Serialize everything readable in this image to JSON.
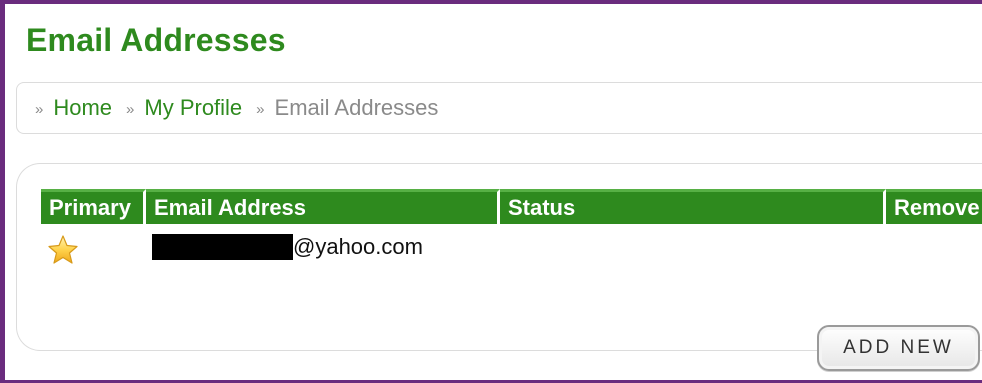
{
  "page": {
    "title": "Email Addresses"
  },
  "breadcrumb": {
    "items": [
      {
        "label": "Home",
        "link": true
      },
      {
        "label": "My Profile",
        "link": true
      },
      {
        "label": "Email Addresses",
        "link": false
      }
    ],
    "separator": "»"
  },
  "table": {
    "headers": [
      "Primary",
      "Email Address",
      "Status",
      "Remove"
    ],
    "rows": [
      {
        "primary": true,
        "email_suffix": "@yahoo.com",
        "status": ""
      }
    ]
  },
  "buttons": {
    "add_new": "ADD NEW"
  },
  "colors": {
    "brand_green": "#2e8a1e",
    "frame_purple": "#6a2c7e"
  },
  "icons": {
    "primary_marker": "star-icon"
  }
}
